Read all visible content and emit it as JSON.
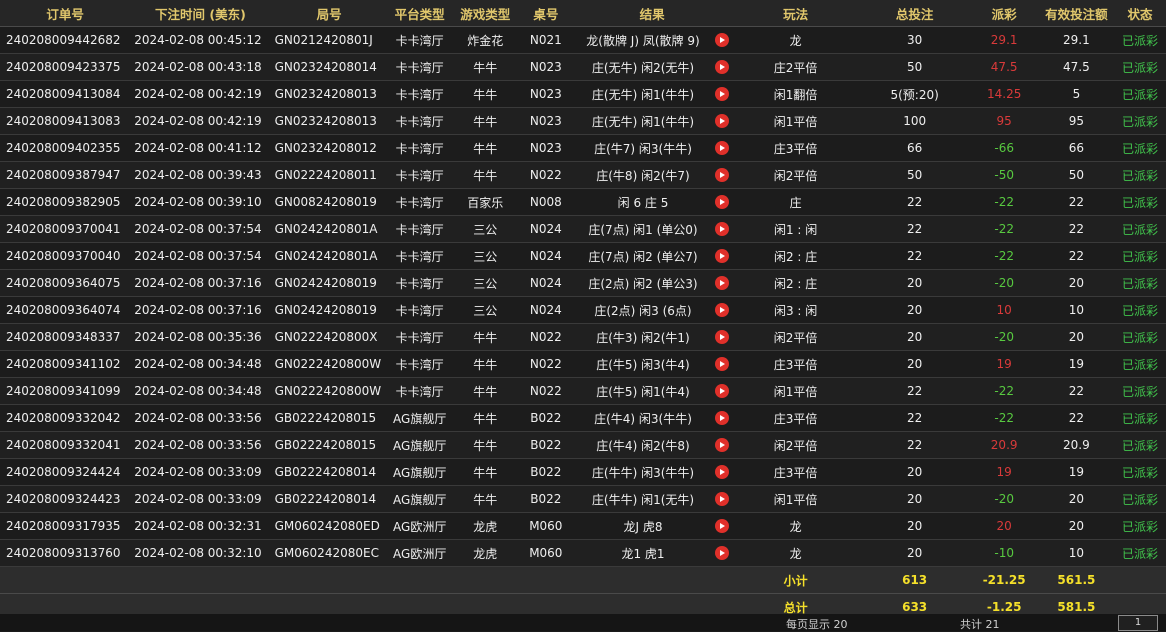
{
  "columns": [
    "订单号",
    "下注时间 (美东)",
    "局号",
    "平台类型",
    "游戏类型",
    "桌号",
    "结果",
    "",
    "玩法",
    "总投注",
    "派彩",
    "有效投注额",
    "状态"
  ],
  "rows": [
    {
      "order": "240208009442682",
      "time": "2024-02-08 00:45:12",
      "round": "GN0212420801J",
      "platform": "卡卡湾厅",
      "game": "炸金花",
      "table": "N021",
      "result": "龙(散牌 J) 凤(散牌 9)",
      "play": "龙",
      "bet": "30",
      "payout": "29.1",
      "payout_type": "win",
      "valid": "29.1",
      "status": "已派彩"
    },
    {
      "order": "240208009423375",
      "time": "2024-02-08 00:43:18",
      "round": "GN02324208014",
      "platform": "卡卡湾厅",
      "game": "牛牛",
      "table": "N023",
      "result": "庄(无牛) 闲2(无牛)",
      "play": "庄2平倍",
      "bet": "50",
      "payout": "47.5",
      "payout_type": "win",
      "valid": "47.5",
      "status": "已派彩"
    },
    {
      "order": "240208009413084",
      "time": "2024-02-08 00:42:19",
      "round": "GN02324208013",
      "platform": "卡卡湾厅",
      "game": "牛牛",
      "table": "N023",
      "result": "庄(无牛) 闲1(牛牛)",
      "play": "闲1翻倍",
      "bet": "5(预:20)",
      "payout": "14.25",
      "payout_type": "win",
      "valid": "5",
      "status": "已派彩"
    },
    {
      "order": "240208009413083",
      "time": "2024-02-08 00:42:19",
      "round": "GN02324208013",
      "platform": "卡卡湾厅",
      "game": "牛牛",
      "table": "N023",
      "result": "庄(无牛) 闲1(牛牛)",
      "play": "闲1平倍",
      "bet": "100",
      "payout": "95",
      "payout_type": "win",
      "valid": "95",
      "status": "已派彩"
    },
    {
      "order": "240208009402355",
      "time": "2024-02-08 00:41:12",
      "round": "GN02324208012",
      "platform": "卡卡湾厅",
      "game": "牛牛",
      "table": "N023",
      "result": "庄(牛7) 闲3(牛牛)",
      "play": "庄3平倍",
      "bet": "66",
      "payout": "-66",
      "payout_type": "lose",
      "valid": "66",
      "status": "已派彩"
    },
    {
      "order": "240208009387947",
      "time": "2024-02-08 00:39:43",
      "round": "GN02224208011",
      "platform": "卡卡湾厅",
      "game": "牛牛",
      "table": "N022",
      "result": "庄(牛8) 闲2(牛7)",
      "play": "闲2平倍",
      "bet": "50",
      "payout": "-50",
      "payout_type": "lose",
      "valid": "50",
      "status": "已派彩"
    },
    {
      "order": "240208009382905",
      "time": "2024-02-08 00:39:10",
      "round": "GN00824208019",
      "platform": "卡卡湾厅",
      "game": "百家乐",
      "table": "N008",
      "result": "闲 6 庄 5",
      "play": "庄",
      "bet": "22",
      "payout": "-22",
      "payout_type": "lose",
      "valid": "22",
      "status": "已派彩"
    },
    {
      "order": "240208009370041",
      "time": "2024-02-08 00:37:54",
      "round": "GN0242420801A",
      "platform": "卡卡湾厅",
      "game": "三公",
      "table": "N024",
      "result": "庄(7点) 闲1 (单公0)",
      "play": "闲1 : 闲",
      "bet": "22",
      "payout": "-22",
      "payout_type": "lose",
      "valid": "22",
      "status": "已派彩"
    },
    {
      "order": "240208009370040",
      "time": "2024-02-08 00:37:54",
      "round": "GN0242420801A",
      "platform": "卡卡湾厅",
      "game": "三公",
      "table": "N024",
      "result": "庄(7点) 闲2 (单公7)",
      "play": "闲2 : 庄",
      "bet": "22",
      "payout": "-22",
      "payout_type": "lose",
      "valid": "22",
      "status": "已派彩"
    },
    {
      "order": "240208009364075",
      "time": "2024-02-08 00:37:16",
      "round": "GN02424208019",
      "platform": "卡卡湾厅",
      "game": "三公",
      "table": "N024",
      "result": "庄(2点) 闲2 (单公3)",
      "play": "闲2 : 庄",
      "bet": "20",
      "payout": "-20",
      "payout_type": "lose",
      "valid": "20",
      "status": "已派彩"
    },
    {
      "order": "240208009364074",
      "time": "2024-02-08 00:37:16",
      "round": "GN02424208019",
      "platform": "卡卡湾厅",
      "game": "三公",
      "table": "N024",
      "result": "庄(2点) 闲3 (6点)",
      "play": "闲3 : 闲",
      "bet": "20",
      "payout": "10",
      "payout_type": "win",
      "valid": "10",
      "status": "已派彩"
    },
    {
      "order": "240208009348337",
      "time": "2024-02-08 00:35:36",
      "round": "GN0222420800X",
      "platform": "卡卡湾厅",
      "game": "牛牛",
      "table": "N022",
      "result": "庄(牛3) 闲2(牛1)",
      "play": "闲2平倍",
      "bet": "20",
      "payout": "-20",
      "payout_type": "lose",
      "valid": "20",
      "status": "已派彩"
    },
    {
      "order": "240208009341102",
      "time": "2024-02-08 00:34:48",
      "round": "GN0222420800W",
      "platform": "卡卡湾厅",
      "game": "牛牛",
      "table": "N022",
      "result": "庄(牛5) 闲3(牛4)",
      "play": "庄3平倍",
      "bet": "20",
      "payout": "19",
      "payout_type": "win",
      "valid": "19",
      "status": "已派彩"
    },
    {
      "order": "240208009341099",
      "time": "2024-02-08 00:34:48",
      "round": "GN0222420800W",
      "platform": "卡卡湾厅",
      "game": "牛牛",
      "table": "N022",
      "result": "庄(牛5) 闲1(牛4)",
      "play": "闲1平倍",
      "bet": "22",
      "payout": "-22",
      "payout_type": "lose",
      "valid": "22",
      "status": "已派彩"
    },
    {
      "order": "240208009332042",
      "time": "2024-02-08 00:33:56",
      "round": "GB02224208015",
      "platform": "AG旗舰厅",
      "game": "牛牛",
      "table": "B022",
      "result": "庄(牛4) 闲3(牛牛)",
      "play": "庄3平倍",
      "bet": "22",
      "payout": "-22",
      "payout_type": "lose",
      "valid": "22",
      "status": "已派彩"
    },
    {
      "order": "240208009332041",
      "time": "2024-02-08 00:33:56",
      "round": "GB02224208015",
      "platform": "AG旗舰厅",
      "game": "牛牛",
      "table": "B022",
      "result": "庄(牛4) 闲2(牛8)",
      "play": "闲2平倍",
      "bet": "22",
      "payout": "20.9",
      "payout_type": "win",
      "valid": "20.9",
      "status": "已派彩"
    },
    {
      "order": "240208009324424",
      "time": "2024-02-08 00:33:09",
      "round": "GB02224208014",
      "platform": "AG旗舰厅",
      "game": "牛牛",
      "table": "B022",
      "result": "庄(牛牛) 闲3(牛牛)",
      "play": "庄3平倍",
      "bet": "20",
      "payout": "19",
      "payout_type": "win",
      "valid": "19",
      "status": "已派彩"
    },
    {
      "order": "240208009324423",
      "time": "2024-02-08 00:33:09",
      "round": "GB02224208014",
      "platform": "AG旗舰厅",
      "game": "牛牛",
      "table": "B022",
      "result": "庄(牛牛) 闲1(无牛)",
      "play": "闲1平倍",
      "bet": "20",
      "payout": "-20",
      "payout_type": "lose",
      "valid": "20",
      "status": "已派彩"
    },
    {
      "order": "240208009317935",
      "time": "2024-02-08 00:32:31",
      "round": "GM060242080ED",
      "platform": "AG欧洲厅",
      "game": "龙虎",
      "table": "M060",
      "result": "龙J 虎8",
      "play": "龙",
      "bet": "20",
      "payout": "20",
      "payout_type": "win",
      "valid": "20",
      "status": "已派彩"
    },
    {
      "order": "240208009313760",
      "time": "2024-02-08 00:32:10",
      "round": "GM060242080EC",
      "platform": "AG欧洲厅",
      "game": "龙虎",
      "table": "M060",
      "result": "龙1 虎1",
      "play": "龙",
      "bet": "20",
      "payout": "-10",
      "payout_type": "lose",
      "valid": "10",
      "status": "已派彩"
    }
  ],
  "subtotal": {
    "label": "小计",
    "bet": "613",
    "payout": "-21.25",
    "valid": "561.5"
  },
  "total": {
    "label": "总计",
    "bet": "633",
    "payout": "-1.25",
    "valid": "581.5"
  },
  "pager": {
    "page_size": "每页显示 20",
    "total_count": "共计 21",
    "goto": "1"
  }
}
